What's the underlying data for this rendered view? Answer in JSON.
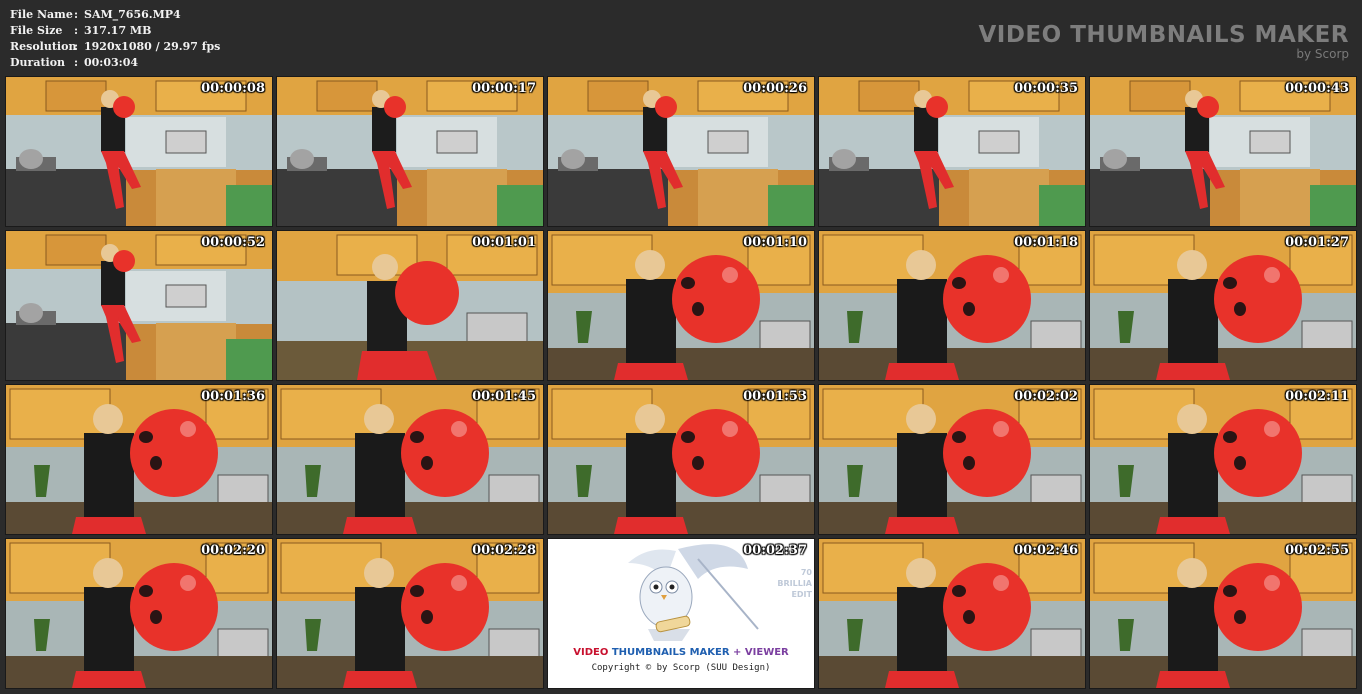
{
  "info": {
    "rows": [
      {
        "key": "File Name",
        "sep": ":",
        "value": "SAM_7656.MP4"
      },
      {
        "key": "File Size",
        "sep": ":",
        "value": "317.17 MB"
      },
      {
        "key": "Resolution",
        "sep": ":",
        "value": "1920x1080 / 29.97 fps"
      },
      {
        "key": "Duration",
        "sep": ":",
        "value": "00:03:04"
      }
    ]
  },
  "brand": {
    "title": "VIDEO THUMBNAILS MAKER",
    "subtitle": "by Scorp"
  },
  "thumbnails": [
    {
      "time": "00:00:08",
      "scene": "wide"
    },
    {
      "time": "00:00:17",
      "scene": "wide"
    },
    {
      "time": "00:00:26",
      "scene": "wide"
    },
    {
      "time": "00:00:35",
      "scene": "wide"
    },
    {
      "time": "00:00:43",
      "scene": "wide"
    },
    {
      "time": "00:00:52",
      "scene": "wide"
    },
    {
      "time": "00:01:01",
      "scene": "mid"
    },
    {
      "time": "00:01:10",
      "scene": "close"
    },
    {
      "time": "00:01:18",
      "scene": "close"
    },
    {
      "time": "00:01:27",
      "scene": "close"
    },
    {
      "time": "00:01:36",
      "scene": "close"
    },
    {
      "time": "00:01:45",
      "scene": "close"
    },
    {
      "time": "00:01:53",
      "scene": "close"
    },
    {
      "time": "00:02:02",
      "scene": "close"
    },
    {
      "time": "00:02:11",
      "scene": "close"
    },
    {
      "time": "00:02:20",
      "scene": "close"
    },
    {
      "time": "00:02:28",
      "scene": "close"
    },
    {
      "time": "00:02:37",
      "scene": "logo"
    },
    {
      "time": "00:02:46",
      "scene": "close"
    },
    {
      "time": "00:02:55",
      "scene": "close"
    }
  ],
  "logo_tile": {
    "word1": "VIDEO ",
    "word2": "THUMBNAILS MAKER",
    "word3": " + VIEWER",
    "copyright": "Copyright © by Scorp (SUU Design)",
    "side1": "BRILLIA",
    "side2": "EDIT",
    "side3": "70"
  },
  "colors": {
    "background": "#2b2b2b",
    "balloon": "#e8322a",
    "cabinet": "#d99a3a"
  }
}
